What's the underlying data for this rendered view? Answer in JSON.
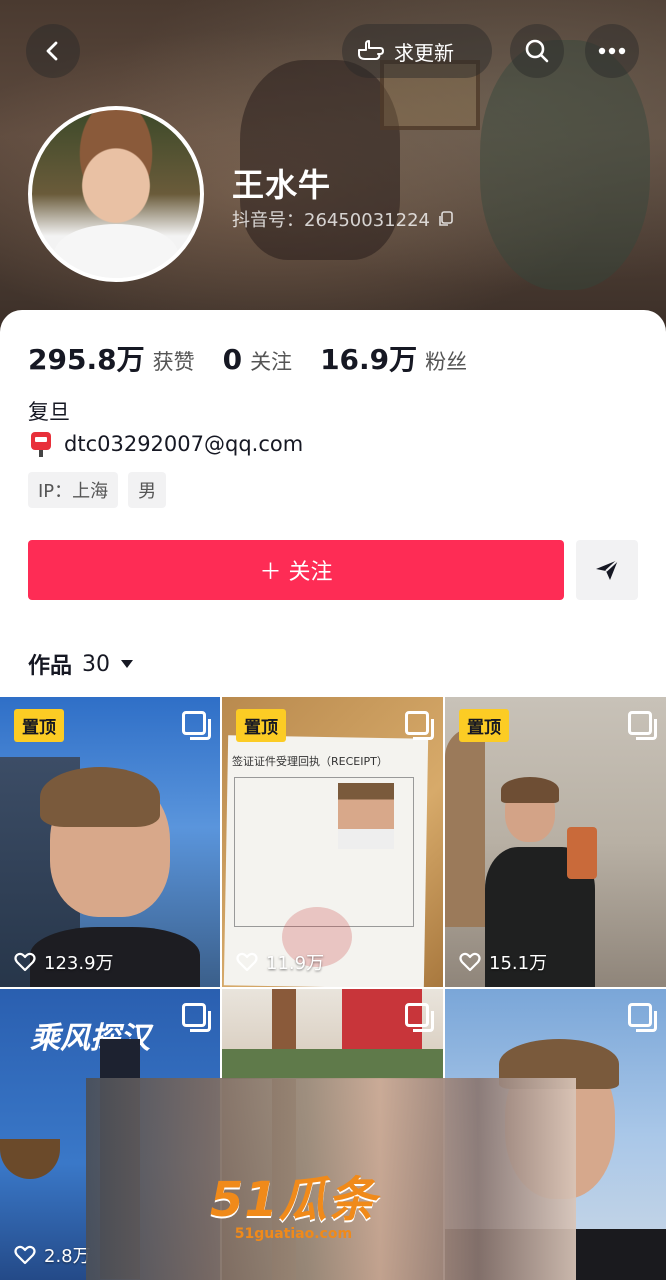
{
  "header": {
    "update_label": "求更新",
    "username": "王水牛",
    "douyin_id": "抖音号：26450031224"
  },
  "stats": [
    {
      "num": "295.8万",
      "label": "获赞"
    },
    {
      "num": "0",
      "label": "关注"
    },
    {
      "num": "16.9万",
      "label": "粉丝"
    }
  ],
  "profile": {
    "bio": "复旦",
    "email": "dtc03292007@qq.com",
    "tags": [
      "IP：上海",
      "男"
    ]
  },
  "actions": {
    "follow_label": "＋ 关注"
  },
  "works": {
    "label": "作品",
    "count": "30"
  },
  "grid": {
    "pinned_label": "置顶",
    "tiles": [
      {
        "likes": "123.9万",
        "pinned": true
      },
      {
        "likes": "11.9万",
        "pinned": true
      },
      {
        "likes": "15.1万",
        "pinned": true
      },
      {
        "likes": "2.8万",
        "pinned": false
      },
      {
        "likes": "",
        "pinned": false
      },
      {
        "likes": "",
        "pinned": false
      }
    ],
    "tile4_text": "乘风探汉",
    "tile2_doc_title": "签证证件受理回执（RECEIPT）"
  },
  "watermark": {
    "main": "51瓜条",
    "sub": "51guatiao.com"
  },
  "colors": {
    "accent": "#fe2c55",
    "pin": "#fccc24"
  }
}
